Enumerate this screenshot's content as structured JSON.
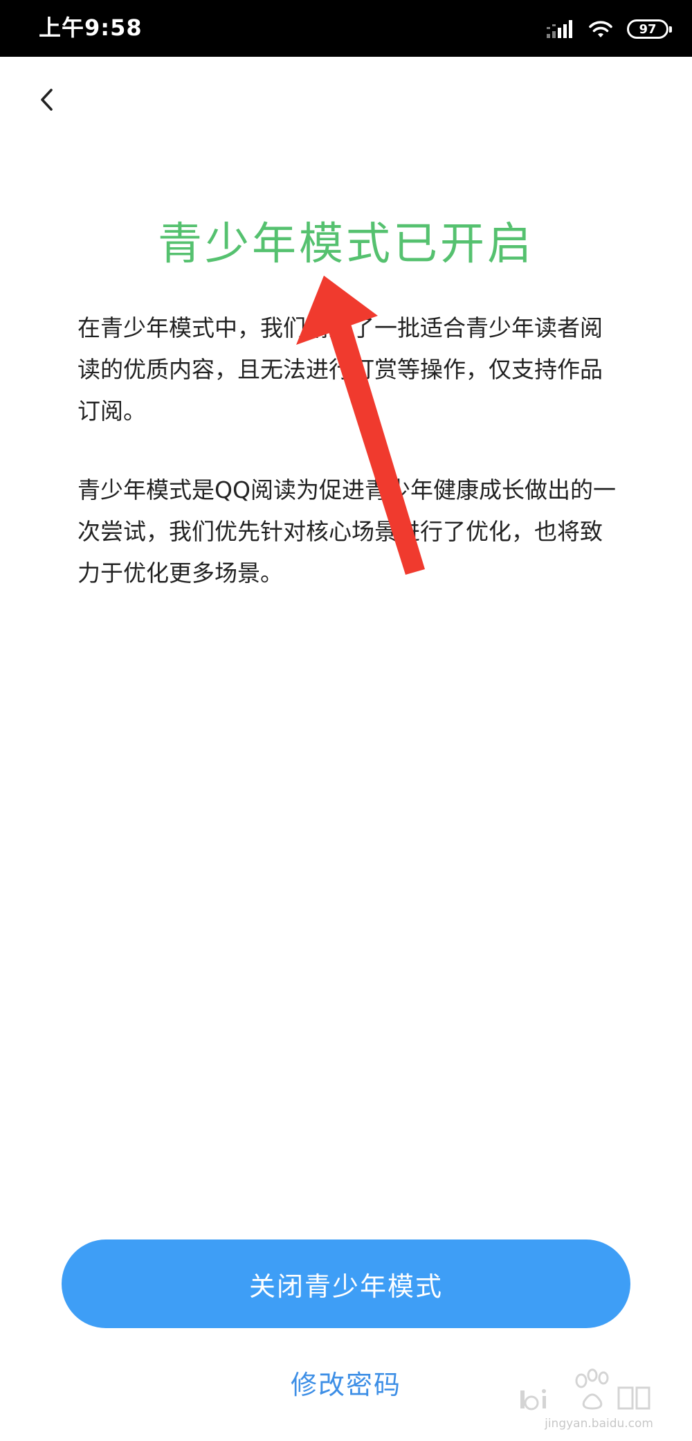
{
  "status_bar": {
    "time": "上午9:58",
    "battery": "97",
    "icons": [
      "signal-icon",
      "wifi-icon",
      "battery-icon"
    ]
  },
  "nav": {
    "back_icon": "chevron-left-icon"
  },
  "page": {
    "title": "青少年模式已开启",
    "paragraphs": [
      "在青少年模式中，我们精选了一批适合青少年读者阅读的优质内容，且无法进行打赏等操作，仅支持作品订阅。",
      "青少年模式是QQ阅读为促进青少年健康成长做出的一次尝试，我们优先针对核心场景进行了优化，也将致力于优化更多场景。"
    ]
  },
  "actions": {
    "close_mode_label": "关闭青少年模式",
    "change_password_label": "修改密码"
  },
  "watermark": {
    "subtext": "jingyan.baidu.com"
  },
  "colors": {
    "title_green": "#55c16f",
    "button_blue": "#3e9ef6",
    "link_blue": "#3e8fe6",
    "arrow_red": "#f03a2e"
  }
}
